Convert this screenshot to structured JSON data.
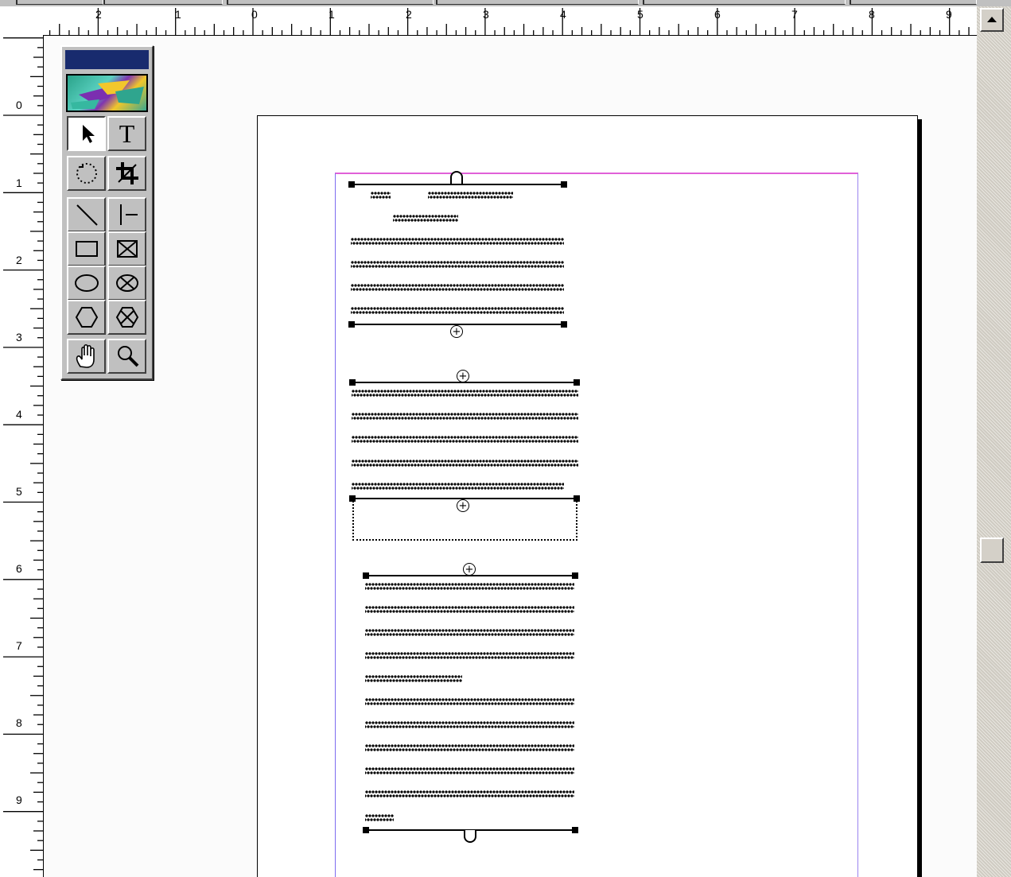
{
  "top_toolbar": {
    "label": "toolbar"
  },
  "horizontal_ruler": {
    "labels": [
      "2",
      "1",
      "0",
      "1",
      "2",
      "3",
      "4",
      "5",
      "6",
      "7",
      "8",
      "9"
    ]
  },
  "vertical_ruler": {
    "labels": [
      "0",
      "1",
      "2",
      "3",
      "4",
      "5",
      "6",
      "7",
      "8",
      "9"
    ]
  },
  "toolbox": {
    "logo_icon": "application-logo-icon",
    "tools": [
      {
        "name": "pointer-tool-icon"
      },
      {
        "name": "text-tool-icon",
        "glyph": "T"
      },
      {
        "name": "rotate-tool-icon"
      },
      {
        "name": "crop-tool-icon"
      },
      {
        "name": "line-tool-icon"
      },
      {
        "name": "perpendicular-line-tool-icon"
      },
      {
        "name": "rectangle-tool-icon"
      },
      {
        "name": "rectangle-frame-tool-icon"
      },
      {
        "name": "ellipse-tool-icon"
      },
      {
        "name": "ellipse-frame-tool-icon"
      },
      {
        "name": "polygon-tool-icon"
      },
      {
        "name": "polygon-frame-tool-icon"
      },
      {
        "name": "hand-tool-icon"
      },
      {
        "name": "zoom-tool-icon"
      }
    ]
  },
  "colors": {
    "margin_guide_top": "#e060d8",
    "column_guide": "#7d6df0",
    "palette_title": "#182b6e",
    "ui_gray": "#c0c0c0"
  },
  "scrollbar": {
    "up_arrow_icon": "arrow-up-icon"
  }
}
